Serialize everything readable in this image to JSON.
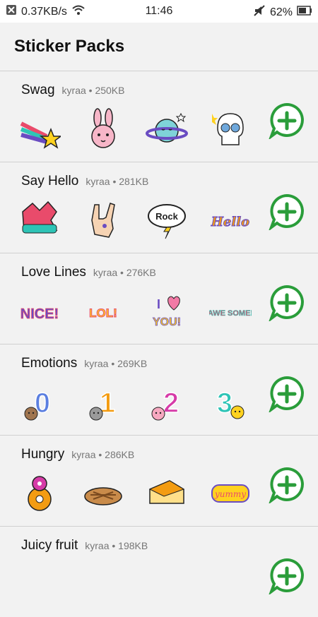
{
  "status_bar": {
    "speed": "0.37KB/s",
    "time": "11:46",
    "battery": "62%"
  },
  "header": {
    "title": "Sticker Packs"
  },
  "packs": [
    {
      "name": "Swag",
      "author": "kyraa",
      "size": "250KB",
      "stickers": [
        "rainbow-star-sticker",
        "bunny-sticker",
        "planet-sticker",
        "skull-sticker"
      ]
    },
    {
      "name": "Say Hello",
      "author": "kyraa",
      "size": "281KB",
      "stickers": [
        "hi-five-hand-sticker",
        "rock-hand-sticker",
        "rock-bubble-sticker",
        "hello-text-sticker"
      ],
      "sticker_text": [
        "",
        "",
        "Rock",
        "Hello"
      ]
    },
    {
      "name": "Love Lines",
      "author": "kyraa",
      "size": "276KB",
      "stickers": [
        "nice-text-sticker",
        "lol-text-sticker",
        "i-heart-you-sticker",
        "awesome-text-sticker"
      ],
      "sticker_text": [
        "NICE!",
        "LOL!",
        "YOU!",
        "AWE SOME!"
      ]
    },
    {
      "name": "Emotions",
      "author": "kyraa",
      "size": "269KB",
      "stickers": [
        "number-0-bear-sticker",
        "number-1-cat-sticker",
        "number-2-pig-sticker",
        "number-3-chick-sticker"
      ],
      "sticker_text": [
        "0",
        "1",
        "2",
        "3"
      ]
    },
    {
      "name": "Hungry",
      "author": "kyraa",
      "size": "286KB",
      "stickers": [
        "donut-sticker",
        "pie-sticker",
        "cake-slice-sticker",
        "yummy-sticker"
      ],
      "sticker_text": [
        "",
        "",
        "",
        "yummy"
      ]
    },
    {
      "name": "Juicy fruit",
      "author": "kyraa",
      "size": "198KB",
      "stickers": []
    }
  ],
  "colors": {
    "accent_green": "#2a9d3a",
    "divider": "#d0d0d0"
  }
}
